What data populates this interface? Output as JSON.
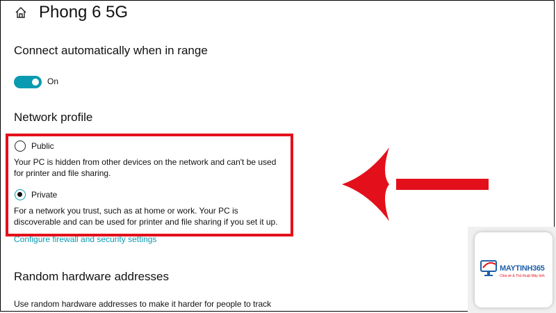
{
  "header": {
    "title": "Phong 6 5G",
    "home_icon": "home-icon"
  },
  "auto_connect": {
    "heading": "Connect automatically when in range",
    "toggle_state": "On",
    "toggle_color": "#0a9bb0"
  },
  "network_profile": {
    "heading": "Network profile",
    "options": [
      {
        "label": "Public",
        "selected": false,
        "description_lines": [
          "Your PC is hidden from other devices on the network and can't be used",
          "for printer and file sharing."
        ]
      },
      {
        "label": "Private",
        "selected": true,
        "description_lines": [
          "For a network you trust, such as at home or work. Your PC is",
          "discoverable and can be used for printer and file sharing if you set it up."
        ]
      }
    ],
    "link": "Configure firewall and security settings"
  },
  "random_hw": {
    "heading": "Random hardware addresses",
    "description_line1": "Use random hardware addresses to make it harder for people to track"
  },
  "annotation": {
    "highlight_color": "#e3101b",
    "arrow_color": "#e3101b"
  },
  "watermark": {
    "brand": "MAYTINH365",
    "tagline": "Chia sẻ & Thủ thuật Máy tính"
  }
}
